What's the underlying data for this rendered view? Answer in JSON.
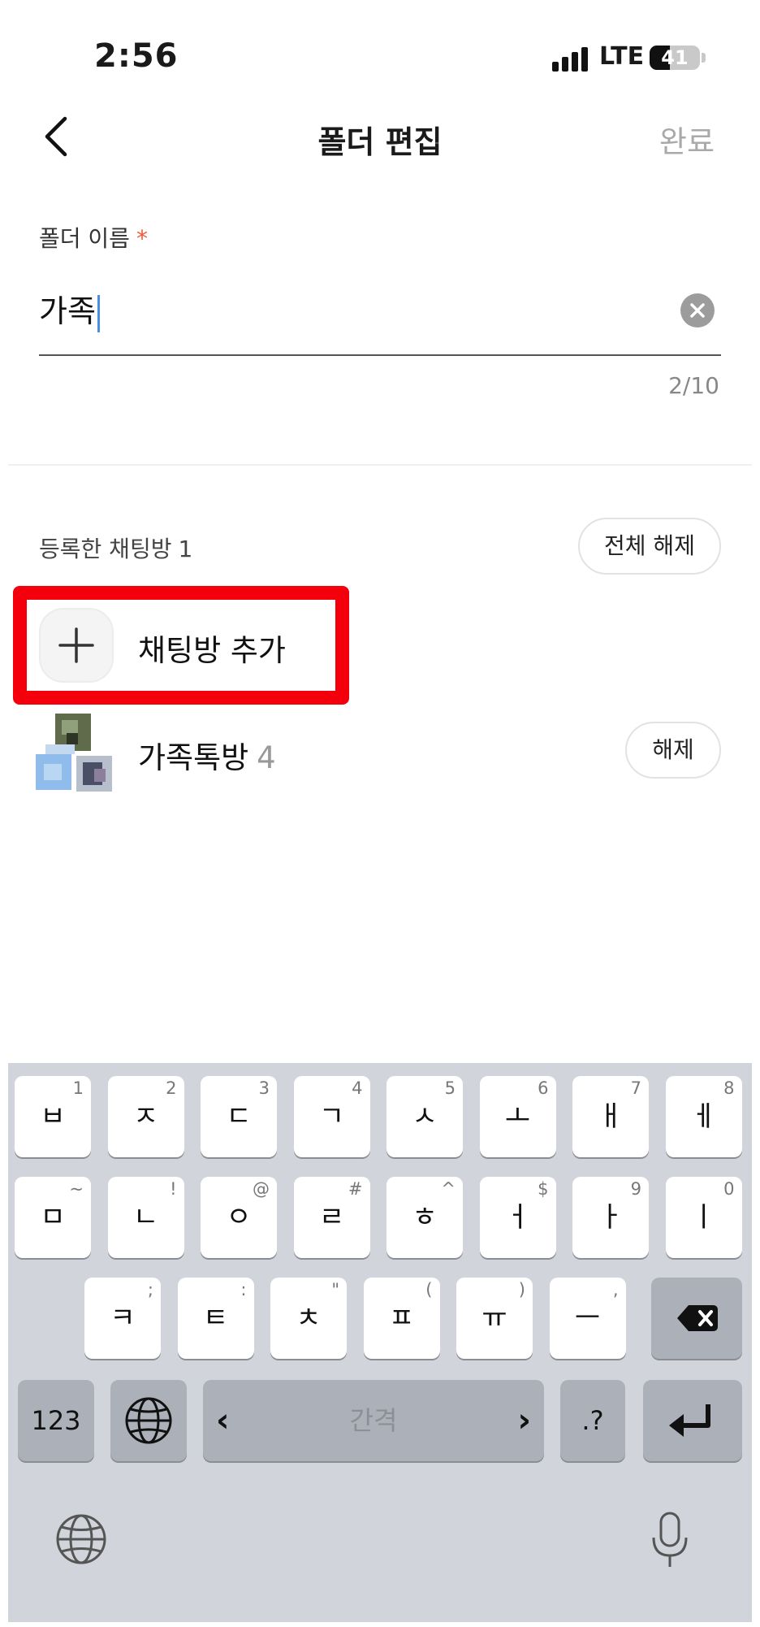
{
  "status_bar": {
    "time": "2:56",
    "network": "LTE",
    "battery_level": "41"
  },
  "nav": {
    "title": "폴더 편집",
    "done_label": "완료"
  },
  "folder_name": {
    "label": "폴더 이름",
    "required_mark": "*",
    "value": "가족",
    "char_count": "2/10"
  },
  "registered": {
    "label": "등록한 채팅방",
    "count": "1",
    "release_all_label": "전체 해제"
  },
  "add_chat": {
    "label": "채팅방 추가"
  },
  "chats": [
    {
      "name": "가족톡방",
      "member_count": "4",
      "release_label": "해제"
    }
  ],
  "keyboard": {
    "row1": [
      {
        "ch": "ㅂ",
        "hint": "1"
      },
      {
        "ch": "ㅈ",
        "hint": "2"
      },
      {
        "ch": "ㄷ",
        "hint": "3"
      },
      {
        "ch": "ㄱ",
        "hint": "4"
      },
      {
        "ch": "ㅅ",
        "hint": "5"
      },
      {
        "ch": "ㅗ",
        "hint": "6"
      },
      {
        "ch": "ㅐ",
        "hint": "7"
      },
      {
        "ch": "ㅔ",
        "hint": "8"
      }
    ],
    "row2": [
      {
        "ch": "ㅁ",
        "hint": "~"
      },
      {
        "ch": "ㄴ",
        "hint": "!"
      },
      {
        "ch": "ㅇ",
        "hint": "@"
      },
      {
        "ch": "ㄹ",
        "hint": "#"
      },
      {
        "ch": "ㅎ",
        "hint": "^"
      },
      {
        "ch": "ㅓ",
        "hint": "$"
      },
      {
        "ch": "ㅏ",
        "hint": "9"
      },
      {
        "ch": "ㅣ",
        "hint": "0"
      }
    ],
    "row3": [
      {
        "ch": "ㅋ",
        "hint": ";"
      },
      {
        "ch": "ㅌ",
        "hint": ":"
      },
      {
        "ch": "ㅊ",
        "hint": "\""
      },
      {
        "ch": "ㅍ",
        "hint": "("
      },
      {
        "ch": "ㅠ",
        "hint": ")"
      },
      {
        "ch": "ㅡ",
        "hint": ","
      }
    ],
    "numbers_label": "123",
    "space_label": "간격",
    "punct_label": ".?"
  }
}
